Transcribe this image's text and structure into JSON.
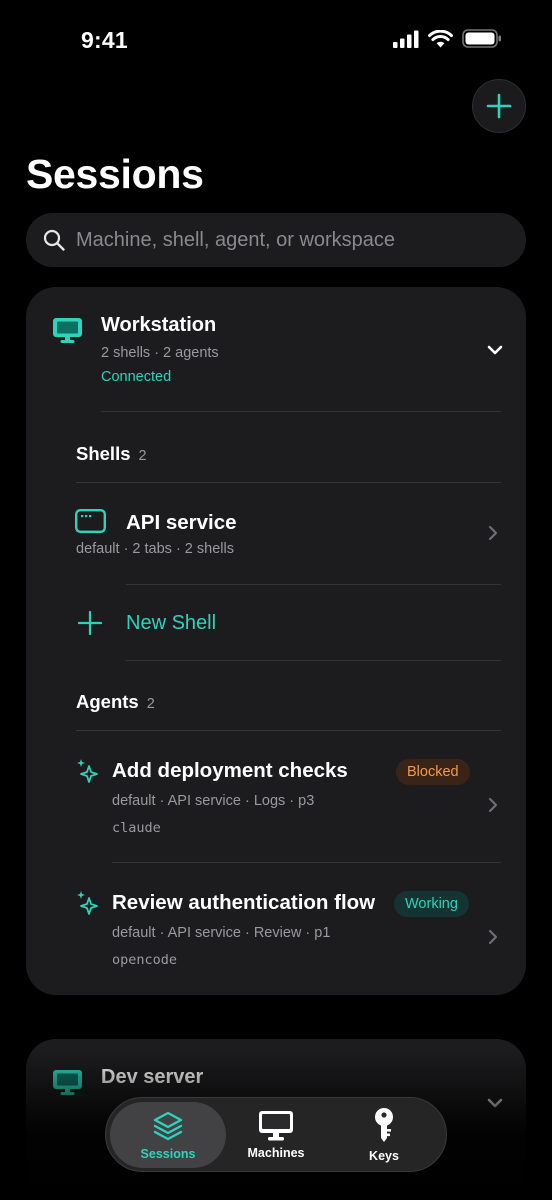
{
  "status_bar": {
    "time": "9:41"
  },
  "header": {
    "title": "Sessions",
    "add_button_icon": "plus-icon"
  },
  "search": {
    "placeholder": "Machine, shell, agent, or workspace",
    "value": ""
  },
  "machines": [
    {
      "name": "Workstation",
      "meta": "2 shells · 2 agents",
      "status": "Connected",
      "expanded": true,
      "shells_section": {
        "title": "Shells",
        "count": "2"
      },
      "shells": [
        {
          "title": "API service",
          "subtitle": "default · 2 tabs · 2 shells"
        }
      ],
      "new_shell_label": "New Shell",
      "agents_section": {
        "title": "Agents",
        "count": "2"
      },
      "agents": [
        {
          "title": "Add deployment checks",
          "badge": "Blocked",
          "subtitle": "default · API service · Logs · p3",
          "tool": "claude"
        },
        {
          "title": "Review authentication flow",
          "badge": "Working",
          "subtitle": "default · API service · Review · p1",
          "tool": "opencode"
        }
      ]
    },
    {
      "name": "Dev server",
      "expanded": false
    }
  ],
  "tab_bar": {
    "tabs": [
      {
        "label": "Sessions",
        "icon": "layers-icon",
        "active": true
      },
      {
        "label": "Machines",
        "icon": "monitor-icon",
        "active": false
      },
      {
        "label": "Keys",
        "icon": "key-icon",
        "active": false
      }
    ]
  },
  "colors": {
    "accent": "#2ed3bb",
    "card": "#1c1c1e",
    "blocked": "#f39a4a",
    "working": "#31d2ba"
  }
}
